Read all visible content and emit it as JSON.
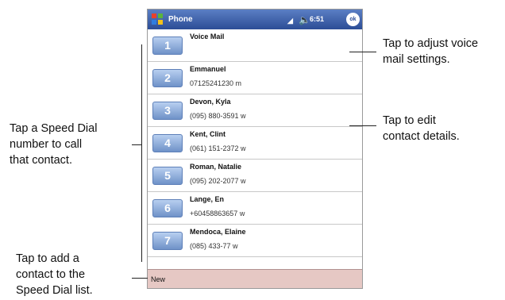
{
  "titlebar": {
    "app_name": "Phone",
    "time": "6:51",
    "ok_label": "ok"
  },
  "speed_dial": [
    {
      "number": "1",
      "name": "Voice Mail",
      "detail": ""
    },
    {
      "number": "2",
      "name": "Emmanuel",
      "detail": "07125241230 m"
    },
    {
      "number": "3",
      "name": "Devon, Kyla",
      "detail": "(095) 880-3591 w"
    },
    {
      "number": "4",
      "name": "Kent, Clint",
      "detail": "(061) 151-2372 w"
    },
    {
      "number": "5",
      "name": "Roman, Natalie",
      "detail": "(095) 202-2077 w"
    },
    {
      "number": "6",
      "name": "Lange, En",
      "detail": "+60458863657 w"
    },
    {
      "number": "7",
      "name": "Mendoca, Elaine",
      "detail": "(085) 433-77 w"
    }
  ],
  "menubar": {
    "new_label": "New"
  },
  "callouts": {
    "voice_mail": [
      "Tap to adjust voice",
      "mail settings."
    ],
    "edit_contact": [
      "Tap to edit",
      "contact details."
    ],
    "speed_dial_call": [
      "Tap a Speed Dial",
      "number to call",
      "that contact."
    ],
    "add_contact": [
      "Tap to add a",
      "contact to the",
      "Speed Dial list."
    ]
  },
  "colors": {
    "titlebar": "#2c4d96",
    "speed_dial_button": "#6f92c8",
    "menubar": "#e6c8c4"
  },
  "icons": [
    "windows-start-icon",
    "signal-icon",
    "volume-icon",
    "ok-button"
  ]
}
